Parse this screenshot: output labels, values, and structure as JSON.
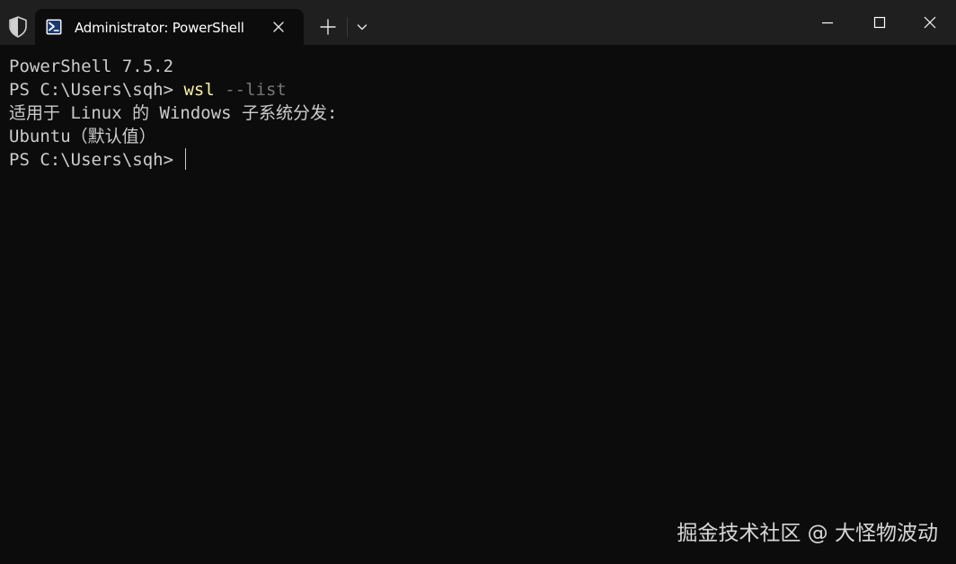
{
  "titlebar": {
    "tab_title": "Administrator: PowerShell",
    "icons": {
      "admin": "shield-icon",
      "tab": "powershell-icon",
      "close_tab": "close-icon",
      "new_tab": "plus-icon",
      "dropdown": "chevron-down-icon",
      "minimize": "minimize-icon",
      "maximize": "maximize-icon",
      "close_window": "close-icon"
    }
  },
  "terminal": {
    "line1": "PowerShell 7.5.2",
    "prompt": "PS C:\\Users\\sqh> ",
    "command": "wsl",
    "argument": " --list",
    "line3": "适用于 Linux 的 Windows 子系统分发:",
    "line4": "Ubuntu（默认值）"
  },
  "watermark": "掘金技术社区 @ 大怪物波动",
  "colors": {
    "background": "#0c0c0c",
    "titlebar": "#1f1f1f",
    "text": "#cccccc",
    "command": "#f9f1a5",
    "argument": "#767676"
  }
}
